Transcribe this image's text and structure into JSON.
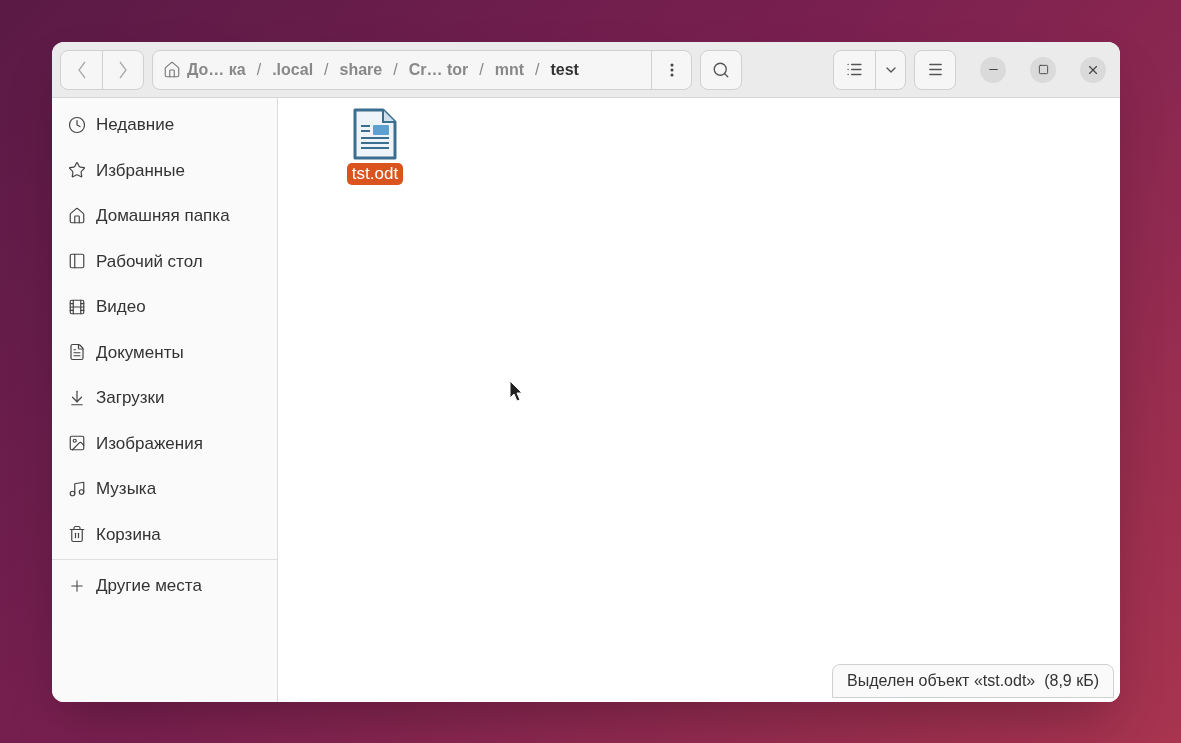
{
  "path_bar": {
    "segments": [
      {
        "label": "До… ка",
        "selected": false
      },
      {
        "label": ".local",
        "selected": false
      },
      {
        "label": "share",
        "selected": false
      },
      {
        "label": "Cr… tor",
        "selected": false
      },
      {
        "label": "mnt",
        "selected": false
      },
      {
        "label": "test",
        "selected": true
      }
    ],
    "separator": "/"
  },
  "sidebar": {
    "items": [
      {
        "label": "Недавние"
      },
      {
        "label": "Избранные"
      },
      {
        "label": "Домашняя папка"
      },
      {
        "label": "Рабочий стол"
      },
      {
        "label": "Видео"
      },
      {
        "label": "Документы"
      },
      {
        "label": "Загрузки"
      },
      {
        "label": "Изображения"
      },
      {
        "label": "Музыка"
      },
      {
        "label": "Корзина"
      }
    ],
    "other_locations": "Другие места"
  },
  "files": [
    {
      "name": "tst.odt",
      "selected": true
    }
  ],
  "status": "Выделен объект «tst.odt»  (8,9 кБ)"
}
